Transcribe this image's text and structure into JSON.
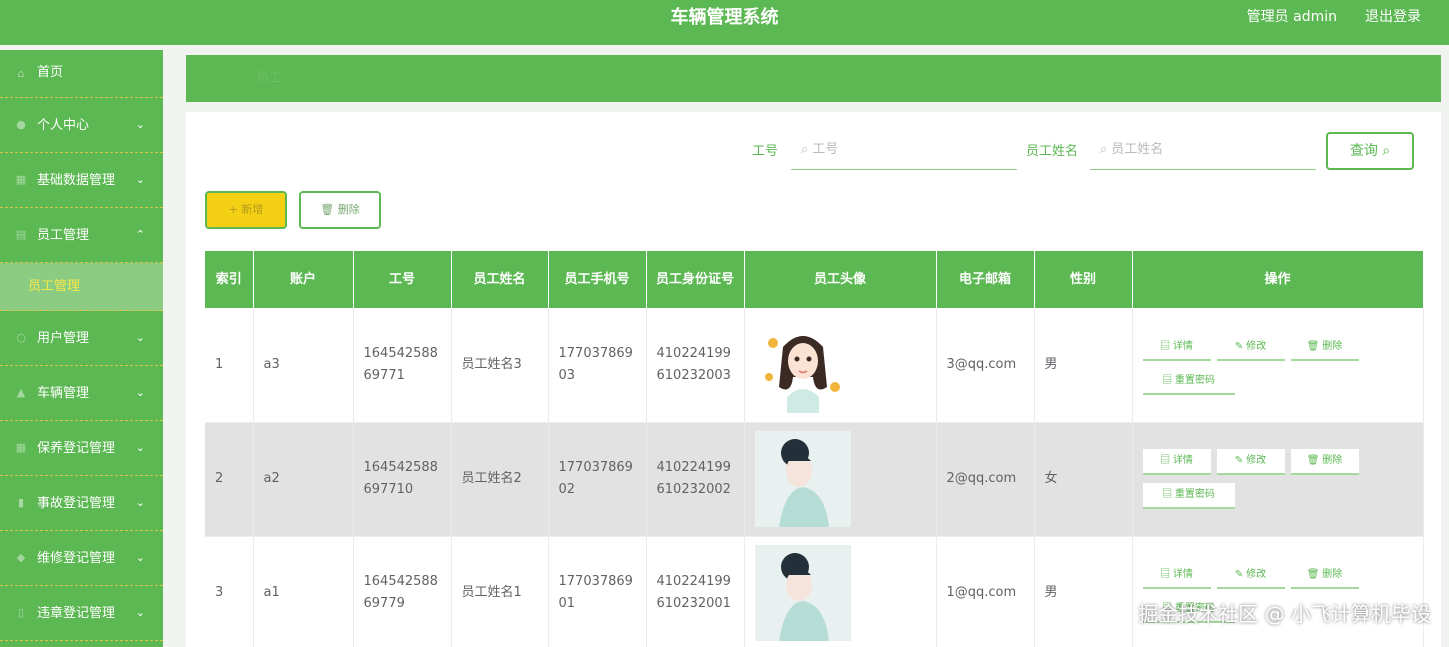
{
  "header": {
    "title": "车辆管理系统",
    "admin_label": "管理员 admin",
    "logout_label": "退出登录"
  },
  "sidebar": {
    "items": [
      {
        "label": "首页",
        "icon": "home-icon",
        "has_chevron": false
      },
      {
        "label": "个人中心",
        "icon": "user-icon",
        "has_chevron": true,
        "chevron": "⌄"
      },
      {
        "label": "基础数据管理",
        "icon": "grid-icon",
        "has_chevron": true,
        "chevron": "⌄"
      },
      {
        "label": "员工管理",
        "icon": "list-icon",
        "has_chevron": true,
        "chevron": "⌃"
      }
    ],
    "subitem": {
      "label": "员工管理"
    },
    "items_after": [
      {
        "label": "用户管理",
        "icon": "user-icon",
        "chevron": "⌄"
      },
      {
        "label": "车辆管理",
        "icon": "car-icon",
        "chevron": "⌄"
      },
      {
        "label": "保养登记管理",
        "icon": "wrench-icon",
        "chevron": "⌄"
      },
      {
        "label": "事故登记管理",
        "icon": "alert-icon",
        "chevron": "⌄"
      },
      {
        "label": "维修登记管理",
        "icon": "tool-icon",
        "chevron": "⌄"
      },
      {
        "label": "违章登记管理",
        "icon": "ticket-icon",
        "chevron": "⌄"
      }
    ]
  },
  "breadcrumb": {
    "text": "员工"
  },
  "search": {
    "field1_label": "工号",
    "field1_placeholder": "工号",
    "field2_label": "员工姓名",
    "field2_placeholder": "员工姓名",
    "query_label": "查询"
  },
  "actions": {
    "add_label": "+ 新增",
    "delete_label": "删除"
  },
  "table": {
    "headers": [
      "索引",
      "账户",
      "工号",
      "员工姓名",
      "员工手机号",
      "员工身份证号",
      "员工头像",
      "电子邮箱",
      "性别",
      "操作"
    ],
    "rows": [
      {
        "index": "1",
        "account": "a3",
        "job_no": "164542588 69771",
        "name": "员工姓名3",
        "phone": "177037869 03",
        "id_card": "410224199 610232003",
        "email": "3@qq.com",
        "gender": "男",
        "avatar": "cartoon"
      },
      {
        "index": "2",
        "account": "a2",
        "job_no": "164542588 697710",
        "name": "员工姓名2",
        "phone": "177037869 02",
        "id_card": "410224199 610232002",
        "email": "2@qq.com",
        "gender": "女",
        "avatar": "photo"
      },
      {
        "index": "3",
        "account": "a1",
        "job_no": "164542588 69779",
        "name": "员工姓名1",
        "phone": "177037869 01",
        "id_card": "410224199 610232001",
        "email": "1@qq.com",
        "gender": "男",
        "avatar": "photo"
      }
    ],
    "op_labels": {
      "detail": "详情",
      "edit": "修改",
      "delete": "删除",
      "reset": "重置密码"
    }
  },
  "watermark": "掘金技术社区 @ 小飞计算机毕设",
  "colors": {
    "primary_green": "#5cb852",
    "add_yellow": "#f3d014",
    "subitem_text": "#f5e94a"
  }
}
